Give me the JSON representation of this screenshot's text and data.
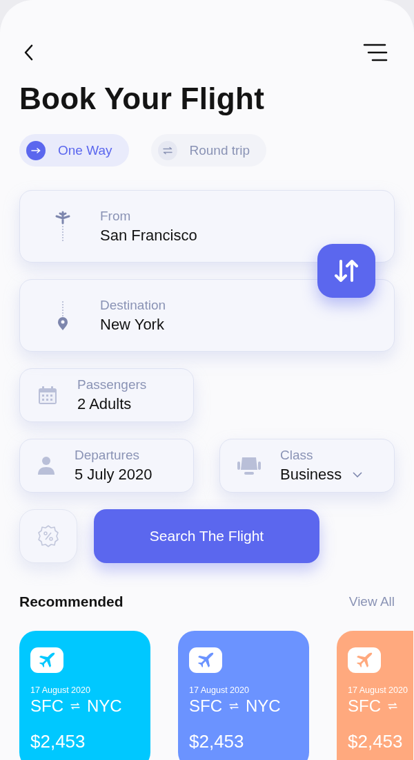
{
  "title": "Book Your Flight",
  "trip_tabs": [
    {
      "label": "One Way",
      "selected": true
    },
    {
      "label": "Round trip",
      "selected": false
    }
  ],
  "from": {
    "label": "From",
    "value": "San Francisco"
  },
  "destination": {
    "label": "Destination",
    "value": "New York"
  },
  "passengers": {
    "label": "Passengers",
    "value": "2 Adults"
  },
  "departures": {
    "label": "Departures",
    "value": "5 July 2020"
  },
  "travel_class": {
    "label": "Class",
    "value": "Business"
  },
  "search_button": "Search The Flight",
  "recommended": {
    "title": "Recommended",
    "view_all": "View All",
    "cards": [
      {
        "date": "17 August 2020",
        "from": "SFC",
        "to": "NYC",
        "price": "$2,453",
        "color": "#00c8ff"
      },
      {
        "date": "17 August 2020",
        "from": "SFC",
        "to": "NYC",
        "price": "$2,453",
        "color": "#6b93ff"
      },
      {
        "date": "17 August 2020",
        "from": "SFC",
        "price": "$2,453",
        "color": "#ffa97e"
      }
    ]
  }
}
